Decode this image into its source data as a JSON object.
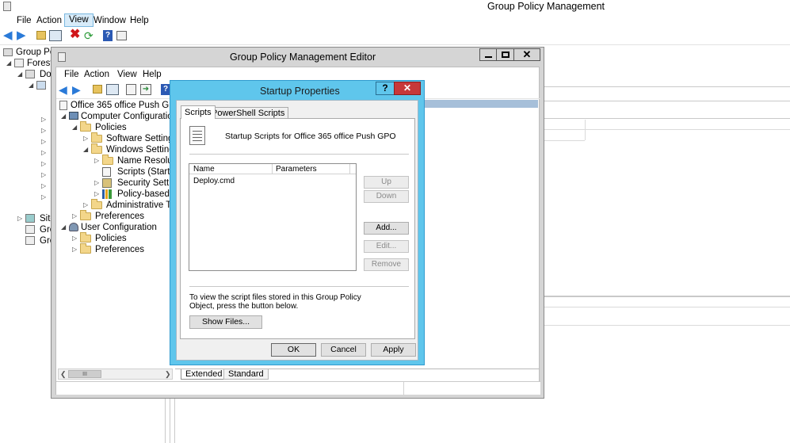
{
  "main_window": {
    "title": "Group Policy Management",
    "menu": [
      "File",
      "Action",
      "View",
      "Window",
      "Help"
    ],
    "tree": [
      "Group Poli",
      "Forest:",
      "Dor"
    ],
    "tree_lower": [
      "Site",
      "Gro",
      "Gro"
    ]
  },
  "editor": {
    "title": "Group Policy Management Editor",
    "menu": [
      "File",
      "Action",
      "View",
      "Help"
    ],
    "root": "Office 365 office Push GPO [D",
    "tree": {
      "computer_config": "Computer Configuration",
      "policies": "Policies",
      "software_settings": "Software Settings",
      "windows_settings": "Windows Settings",
      "name_resolution": "Name Resolutio",
      "scripts": "Scripts (Startup/",
      "security_settings": "Security Setting",
      "policy_qos": "Policy-based Qo",
      "admin_templates": "Administrative Tem",
      "preferences": "Preferences",
      "user_config": "User Configuration",
      "user_policies": "Policies",
      "user_preferences": "Preferences"
    },
    "tabs": [
      "Extended",
      "Standard"
    ],
    "scrollbar_grip": "III"
  },
  "dialog": {
    "title": "Startup Properties",
    "help_btn": "?",
    "close_btn": "✕",
    "tabs": [
      "Scripts",
      "PowerShell Scripts"
    ],
    "heading": "Startup Scripts for Office 365 office Push GPO",
    "columns": [
      "Name",
      "Parameters"
    ],
    "rows": [
      {
        "name": "Deploy.cmd",
        "params": ""
      }
    ],
    "side_buttons": {
      "up": "Up",
      "down": "Down",
      "add": "Add...",
      "edit": "Edit...",
      "remove": "Remove"
    },
    "info": "To view the script files stored in this Group Policy Object, press the button below.",
    "show_files": "Show Files...",
    "ok": "OK",
    "cancel": "Cancel",
    "apply": "Apply"
  }
}
